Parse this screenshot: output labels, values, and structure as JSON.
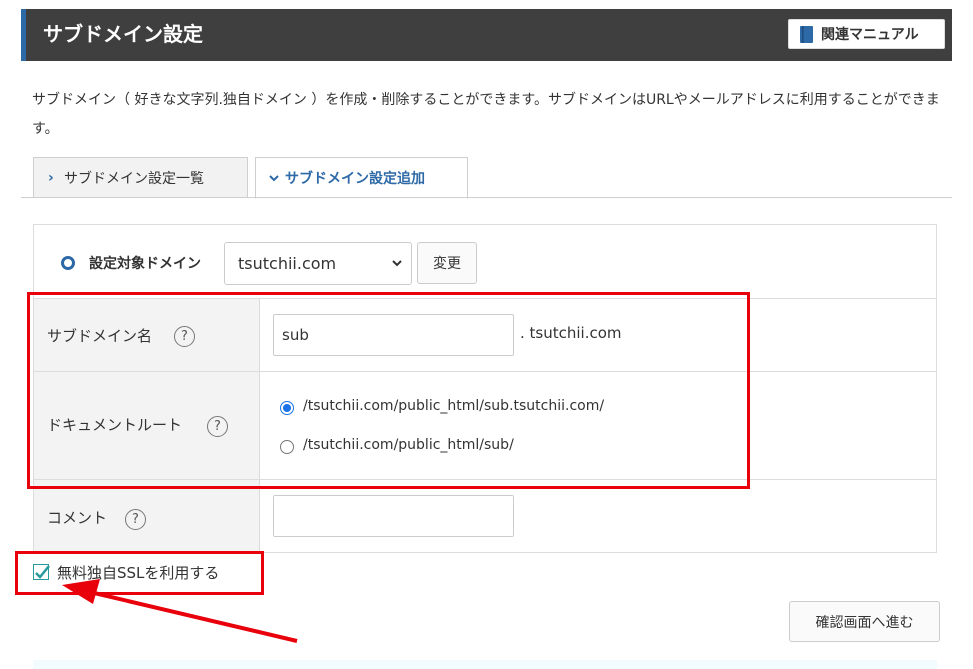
{
  "header": {
    "title": "サブドメイン設定",
    "manual_label": "関連マニュアル"
  },
  "description": "サブドメイン（ 好きな文字列.独自ドメイン ）を作成・削除することができます。サブドメインはURLやメールアドレスに利用することができます。",
  "tabs": [
    {
      "label": "サブドメイン設定一覧",
      "active": false
    },
    {
      "label": "サブドメイン設定追加",
      "active": true
    }
  ],
  "form": {
    "target_domain_label": "設定対象ドメイン",
    "selected_domain": "tsutchii.com",
    "change_button": "変更",
    "subdomain_label": "サブドメイン名",
    "subdomain_value": "sub",
    "subdomain_suffix": ". tsutchii.com",
    "docroot_label": "ドキュメントルート",
    "docroot_options": [
      {
        "label": "/tsutchii.com/public_html/sub.tsutchii.com/",
        "checked": true
      },
      {
        "label": "/tsutchii.com/public_html/sub/",
        "checked": false
      }
    ],
    "comment_label": "コメント",
    "comment_value": "",
    "help_glyph": "?",
    "ssl_label": "無料独自SSLを利用する",
    "ssl_checked": true,
    "confirm_button": "確認画面へ進む"
  },
  "colors": {
    "header_bg": "#3f3f3f",
    "accent": "#2d69a6",
    "annotation_red": "#e8000b",
    "checkbox_teal": "#2b9a9a"
  }
}
